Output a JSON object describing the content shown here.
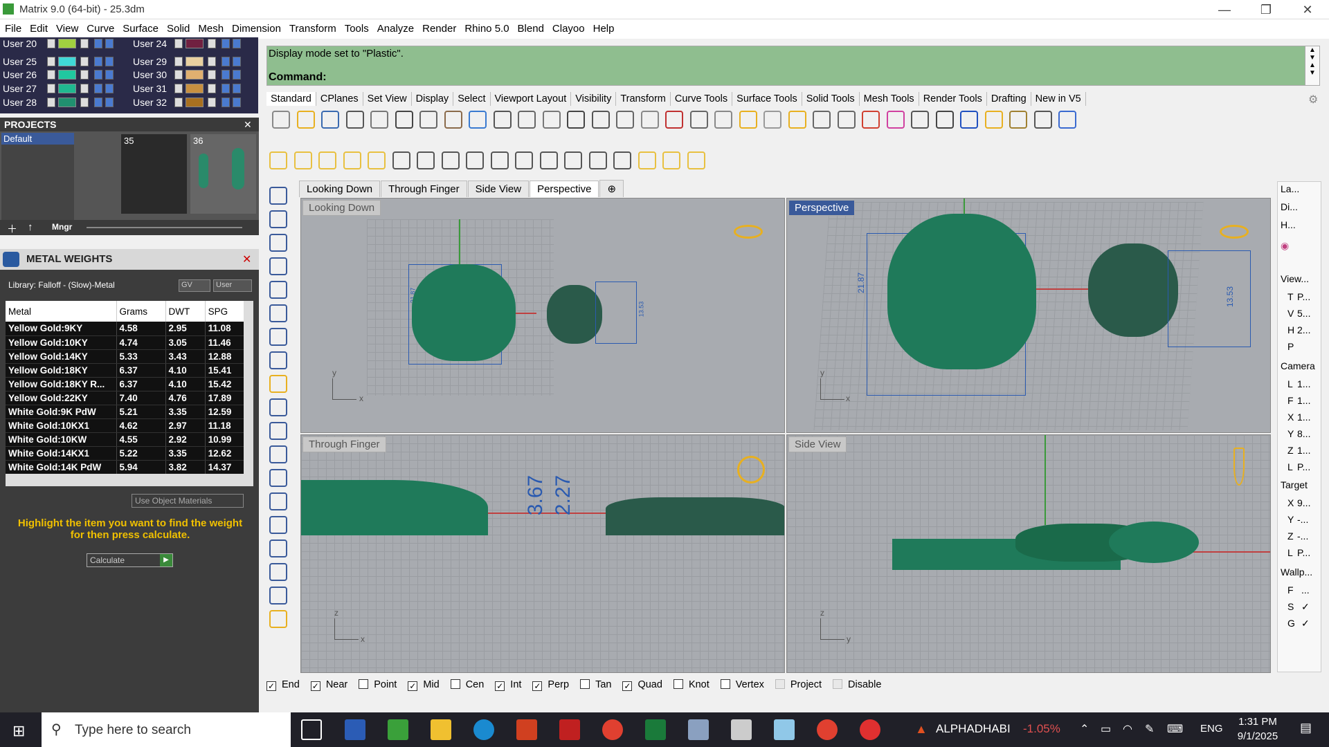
{
  "window": {
    "title": "Matrix 9.0 (64-bit) - 25.3dm",
    "minimize": "—",
    "restore": "❐",
    "close": "✕"
  },
  "menu": [
    "File",
    "Edit",
    "View",
    "Curve",
    "Surface",
    "Solid",
    "Mesh",
    "Dimension",
    "Transform",
    "Tools",
    "Analyze",
    "Render",
    "Rhino 5.0",
    "Blend",
    "Clayoo",
    "Help"
  ],
  "layers": {
    "left": [
      {
        "name": "User 20",
        "color": "#a0d040"
      },
      {
        "name": "User 25",
        "color": "#40d8d8"
      },
      {
        "name": "User 26",
        "color": "#20c8a0"
      },
      {
        "name": "User 27",
        "color": "#20b890"
      },
      {
        "name": "User 28",
        "color": "#209070"
      }
    ],
    "right": [
      {
        "name": "User 24",
        "color": "#702040"
      },
      {
        "name": "User 29",
        "color": "#e8d0a0"
      },
      {
        "name": "User 30",
        "color": "#e0b070"
      },
      {
        "name": "User 31",
        "color": "#c89040"
      },
      {
        "name": "User 32",
        "color": "#a87020"
      }
    ]
  },
  "projects": {
    "title": "PROJECTS",
    "default_item": "Default",
    "slot1": "35",
    "slot2": "36",
    "mgr_button": "Mngr"
  },
  "metal_weights": {
    "title": "METAL WEIGHTS",
    "library": "Library: Falloff - (Slow)-Metal",
    "gv_label": "GV",
    "user_label": "User",
    "columns": [
      "Metal",
      "Grams",
      "DWT",
      "SPG"
    ],
    "rows": [
      [
        "Yellow Gold:9KY",
        "4.58",
        "2.95",
        "11.08"
      ],
      [
        "Yellow Gold:10KY",
        "4.74",
        "3.05",
        "11.46"
      ],
      [
        "Yellow Gold:14KY",
        "5.33",
        "3.43",
        "12.88"
      ],
      [
        "Yellow Gold:18KY",
        "6.37",
        "4.10",
        "15.41"
      ],
      [
        "Yellow Gold:18KY R...",
        "6.37",
        "4.10",
        "15.42"
      ],
      [
        "Yellow Gold:22KY",
        "7.40",
        "4.76",
        "17.89"
      ],
      [
        "White Gold:9K PdW",
        "5.21",
        "3.35",
        "12.59"
      ],
      [
        "White Gold:10KX1",
        "4.62",
        "2.97",
        "11.18"
      ],
      [
        "White Gold:10KW",
        "4.55",
        "2.92",
        "10.99"
      ],
      [
        "White Gold:14KX1",
        "5.22",
        "3.35",
        "12.62"
      ],
      [
        "White Gold:14K PdW",
        "5.94",
        "3.82",
        "14.37"
      ]
    ],
    "use_object_materials": "Use Object Materials",
    "instruction": "Highlight the item you want to find the weight for then press calculate.",
    "calculate_button": "Calculate"
  },
  "command": {
    "line1": "Display mode set to \"Plastic\".",
    "prompt": "Command:"
  },
  "toolbar_tabs": [
    "Standard",
    "CPlanes",
    "Set View",
    "Display",
    "Select",
    "Viewport Layout",
    "Visibility",
    "Transform",
    "Curve Tools",
    "Surface Tools",
    "Solid Tools",
    "Mesh Tools",
    "Render Tools",
    "Drafting",
    "New in V5"
  ],
  "viewport_tabs": [
    "Looking Down",
    "Through Finger",
    "Side View",
    "Perspective"
  ],
  "viewports": {
    "top_left": {
      "label": "Looking Down",
      "dim": "13.53",
      "dim2": "21.87"
    },
    "top_right": {
      "label": "Perspective",
      "dim": "21.87",
      "dim2": "13.53"
    },
    "bottom_left": {
      "label": "Through Finger",
      "dim": "3.67",
      "dim2": "2.27"
    },
    "bottom_right": {
      "label": "Side View"
    }
  },
  "osnaps": [
    {
      "label": "End",
      "checked": true
    },
    {
      "label": "Near",
      "checked": true
    },
    {
      "label": "Point",
      "checked": false
    },
    {
      "label": "Mid",
      "checked": true
    },
    {
      "label": "Cen",
      "checked": false
    },
    {
      "label": "Int",
      "checked": true
    },
    {
      "label": "Perp",
      "checked": true
    },
    {
      "label": "Tan",
      "checked": false
    },
    {
      "label": "Quad",
      "checked": true
    },
    {
      "label": "Knot",
      "checked": false
    },
    {
      "label": "Vertex",
      "checked": false
    },
    {
      "label": "Project",
      "checked": false
    },
    {
      "label": "Disable",
      "checked": false
    }
  ],
  "right_panel": {
    "tabs": [
      "La...",
      "Di...",
      "H..."
    ],
    "view_label": "View...",
    "view_rows": [
      [
        "T",
        "P..."
      ],
      [
        "V",
        "5..."
      ],
      [
        "H",
        "2..."
      ],
      [
        "P",
        ""
      ]
    ],
    "camera_label": "Camera",
    "camera_rows": [
      [
        "L",
        "1..."
      ],
      [
        "F",
        "1..."
      ],
      [
        "X",
        "1..."
      ],
      [
        "Y",
        "8..."
      ],
      [
        "Z",
        "1..."
      ],
      [
        "L",
        "P..."
      ]
    ],
    "target_label": "Target",
    "target_rows": [
      [
        "X",
        "9..."
      ],
      [
        "Y",
        "-..."
      ],
      [
        "Z",
        "-..."
      ],
      [
        "L",
        "P..."
      ]
    ],
    "wallp_label": "Wallp...",
    "wallp_rows": [
      [
        "F",
        "..."
      ],
      [
        "S",
        "✓"
      ],
      [
        "G",
        "✓"
      ]
    ]
  },
  "taskbar": {
    "search_placeholder": "Type here to search",
    "stock_name": "ALPHADHABI",
    "stock_change": "-1.05%",
    "lang": "ENG",
    "time": "1:31 PM",
    "date": "9/1/2025"
  }
}
